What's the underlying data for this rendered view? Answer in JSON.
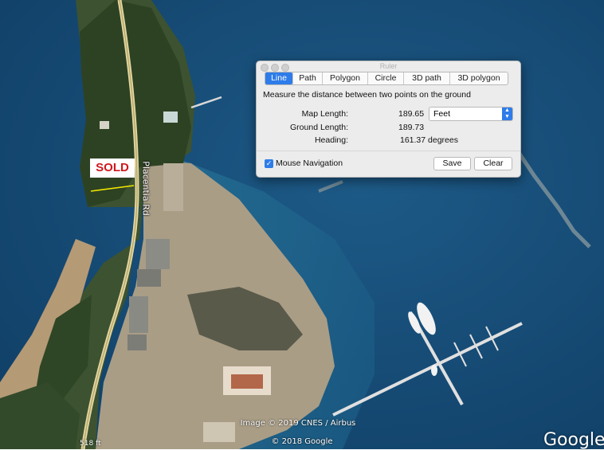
{
  "map": {
    "sold_label": "SOLD",
    "road_label": "Placentia Rd",
    "imagery_credit": "Image © 2019 CNES / Airbus",
    "copyright": "© 2018 Google",
    "scale_label": "518 ft",
    "brand": "Google"
  },
  "ruler": {
    "window_title": "Ruler",
    "tabs": [
      {
        "label": "Line",
        "active": true
      },
      {
        "label": "Path"
      },
      {
        "label": "Polygon"
      },
      {
        "label": "Circle"
      },
      {
        "label": "3D path"
      },
      {
        "label": "3D polygon"
      }
    ],
    "description": "Measure the distance between two points on the ground",
    "map_length": {
      "label": "Map Length:",
      "value": "189.65"
    },
    "unit": "Feet",
    "ground_length": {
      "label": "Ground Length:",
      "value": "189.73"
    },
    "heading": {
      "label": "Heading:",
      "value": "161.37 degrees"
    },
    "mouse_navigation": {
      "label": "Mouse Navigation",
      "checked": true
    },
    "save_label": "Save",
    "clear_label": "Clear"
  },
  "colors": {
    "accent": "#2e7ce9",
    "sold_text": "#d0181c",
    "measure_line": "#f2e600"
  }
}
